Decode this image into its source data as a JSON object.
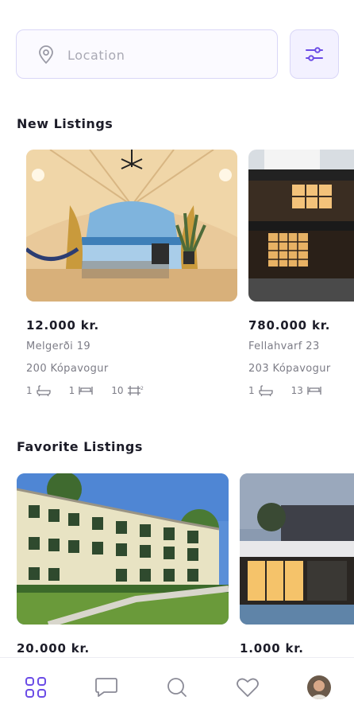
{
  "search": {
    "placeholder": "Location"
  },
  "sections": {
    "new_listings": "New Listings",
    "favorite_listings": "Favorite Listings"
  },
  "new_listings": [
    {
      "price": "12.000 kr.",
      "street": "Melgerði 19",
      "city": "200 Kópavogur",
      "baths": "1",
      "beds": "1",
      "area": "10"
    },
    {
      "price": "780.000 kr.",
      "street": "Fellahvarf 23",
      "city": "203 Kópavogur",
      "baths": "1",
      "beds": "13"
    }
  ],
  "favorite_listings": [
    {
      "price": "20.000 kr."
    },
    {
      "price": "1.000 kr."
    }
  ],
  "colors": {
    "accent": "#6b4ce6",
    "muted": "#7c7c86",
    "border": "#d9d6f7"
  },
  "icons": {
    "search": "map-pin-icon",
    "filter": "sliders-icon",
    "nav": [
      "grid-icon",
      "chat-icon",
      "search-icon",
      "heart-icon",
      "avatar"
    ]
  }
}
